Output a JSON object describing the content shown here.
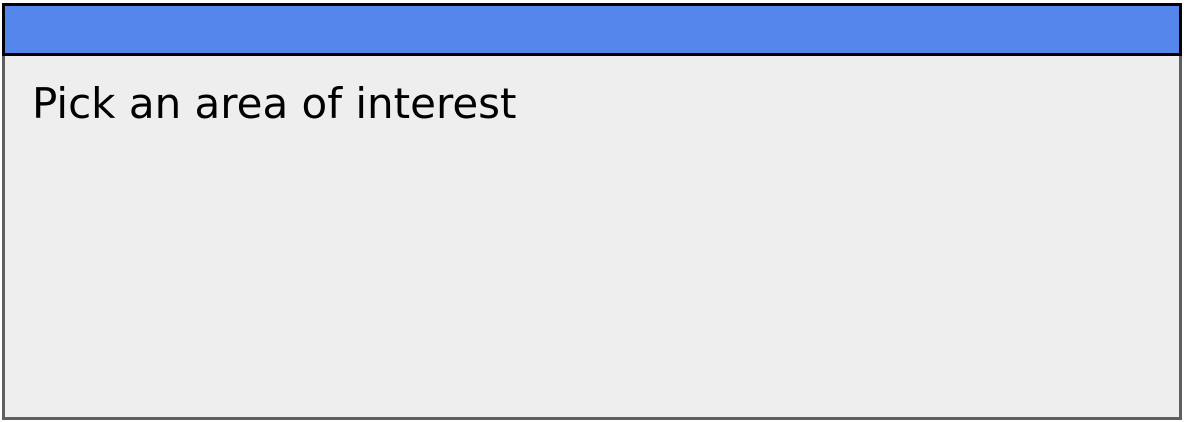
{
  "window": {
    "title": "",
    "prompt": "Pick an area of interest"
  },
  "colors": {
    "title_bar": "#5486ec",
    "window_bg": "#eeeeee",
    "window_border": "#5f5f5f",
    "title_border": "#000000"
  }
}
